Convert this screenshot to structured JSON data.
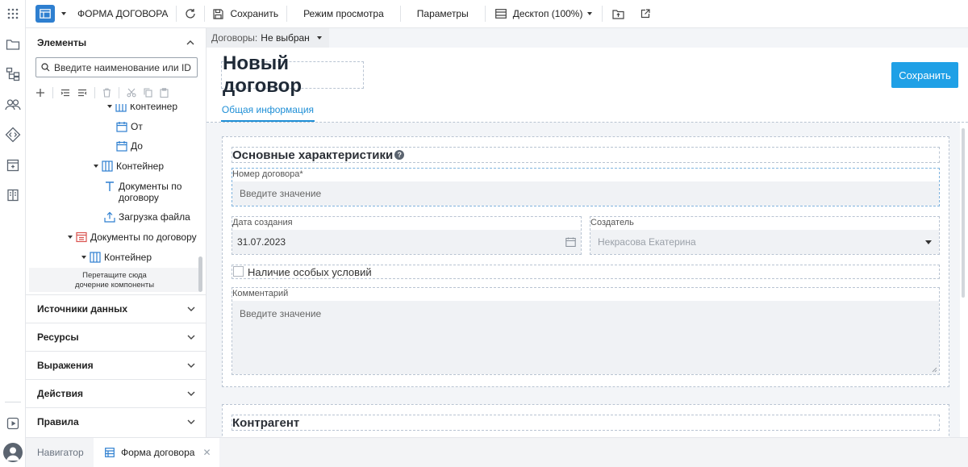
{
  "toolbar": {
    "form_title": "ФОРМА ДОГОВОРА",
    "save_label": "Сохранить",
    "view_mode_label": "Режим просмотра",
    "params_label": "Параметры",
    "device_label": "Десктоп (100%)"
  },
  "left_panel": {
    "elements_header": "Элементы",
    "search_placeholder": "Введите наименование или ID",
    "tree": {
      "container_partial": "Контейнер",
      "from": "От",
      "to": "До",
      "container2": "Контейнер",
      "docs_line1": "Документы по",
      "docs_line2": "договору",
      "upload": "Загрузка файла",
      "docs_by_contract": "Документы по договору",
      "container3": "Контейнер"
    },
    "dropzone_line1": "Перетащите сюда",
    "dropzone_line2": "дочерние компоненты",
    "sections": [
      "Источники данных",
      "Ресурсы",
      "Выражения",
      "Действия",
      "Правила"
    ]
  },
  "bottom_tabs": {
    "navigator": "Навигатор",
    "form": "Форма договора"
  },
  "main": {
    "context_label": "Договоры:",
    "context_value": "Не выбран",
    "page_title": "Новый договор",
    "save_button": "Сохранить",
    "tab_general": "Общая информация",
    "section_main": "Основные характеристики",
    "contract_number_label": "Номер договора*",
    "contract_number_placeholder": "Введите значение",
    "created_date_label": "Дата создания",
    "created_date_value": "31.07.2023",
    "creator_label": "Создатель",
    "creator_value": "Некрасова Екатерина",
    "special_conditions_label": "Наличие особых условий",
    "comment_label": "Комментарий",
    "comment_placeholder": "Введите значение",
    "section_counterparty": "Контрагент"
  },
  "colors": {
    "accent": "#1fa0e6",
    "tab_active": "#1f8fd6",
    "icon_blue": "#2e7fd0",
    "icon_red": "#d9534f"
  }
}
